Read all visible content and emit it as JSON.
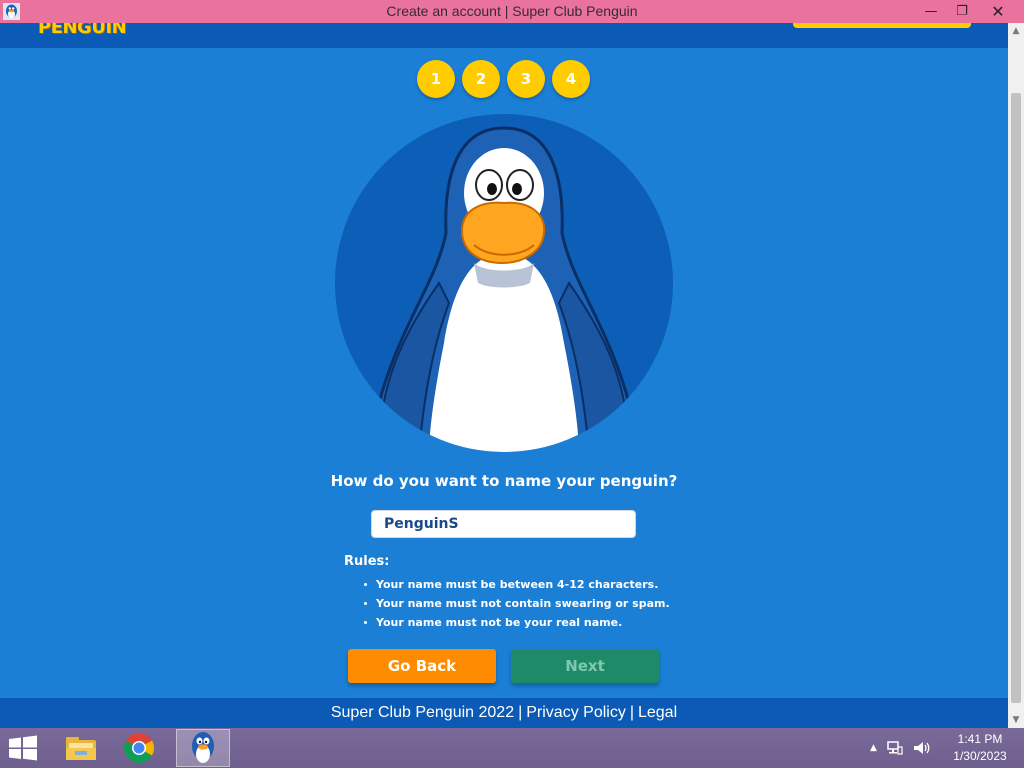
{
  "window": {
    "title": "Create an account | Super Club Penguin",
    "minimize_glyph": "—",
    "restore_glyph": "❐",
    "close_glyph": "✕"
  },
  "header": {
    "logo_text": "PENGUIN"
  },
  "steps": [
    "1",
    "2",
    "3",
    "4"
  ],
  "form": {
    "prompt": "How do you want to name your penguin?",
    "name_value": "PenguinS",
    "rules_title": "Rules:",
    "rules": [
      "Your name must be between 4-12 characters.",
      "Your name must not contain swearing or spam.",
      "Your name must not be your real name."
    ],
    "go_back_label": "Go Back",
    "next_label": "Next"
  },
  "footer": {
    "site": "Super Club Penguin 2022",
    "sep": "|",
    "privacy": "Privacy Policy",
    "legal": "Legal"
  },
  "taskbar": {
    "time": "1:41 PM",
    "date": "1/30/2023"
  },
  "colors": {
    "titlebar": "#e9739c",
    "page_bg": "#1b7fd6",
    "header_bg": "#0b5ab6",
    "step_yellow": "#ffcc00",
    "go_back_orange": "#ff8c00",
    "next_green": "#1f8a68"
  },
  "icons": {
    "app": "penguin-app-icon",
    "start": "windows-logo-icon",
    "explorer": "file-explorer-icon",
    "chrome": "chrome-icon",
    "network": "network-icon",
    "volume": "speaker-icon"
  }
}
